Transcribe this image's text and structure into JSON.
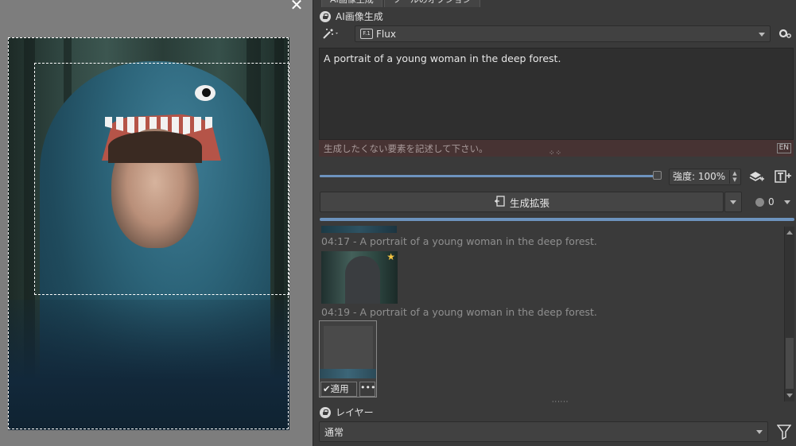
{
  "canvas": {
    "close_glyph": "✕"
  },
  "tabs": [
    {
      "label": "AI画像生成",
      "active": true
    },
    {
      "label": "ツールのオプション",
      "active": false
    }
  ],
  "ai_section": {
    "title": "AI画像生成",
    "model": "Flux",
    "model_badge": "F.1",
    "prompt": "A portrait of a young woman in the deep forest.",
    "negative_placeholder": "生成したくない要素を記述して下さい。",
    "lang_badge": "EN",
    "strength_label": "強度: 100%",
    "strength_value": 1.0,
    "generate_label": "生成拡張",
    "queue_count": "0",
    "progress": 1.0
  },
  "history": [
    {
      "label": "04:17 - A portrait of a young woman in the deep forest.",
      "starred": true
    },
    {
      "label": "04:19 - A portrait of a young woman in the deep forest.",
      "starred": false
    }
  ],
  "history_actions": {
    "apply_label": "適用",
    "more_label": "•••"
  },
  "layer_section": {
    "title": "レイヤー",
    "blend_mode": "通常"
  },
  "icons": {
    "wand": "wand-icon",
    "settings": "gear-icon",
    "layers": "layers-add-icon",
    "text_add": "text-add-icon",
    "expand": "expand-icon",
    "filter": "filter-icon",
    "check": "check-icon",
    "star": "star-icon"
  },
  "colors": {
    "accent": "#6d93be",
    "negative_bg": "#473333",
    "star": "#f5c542"
  }
}
